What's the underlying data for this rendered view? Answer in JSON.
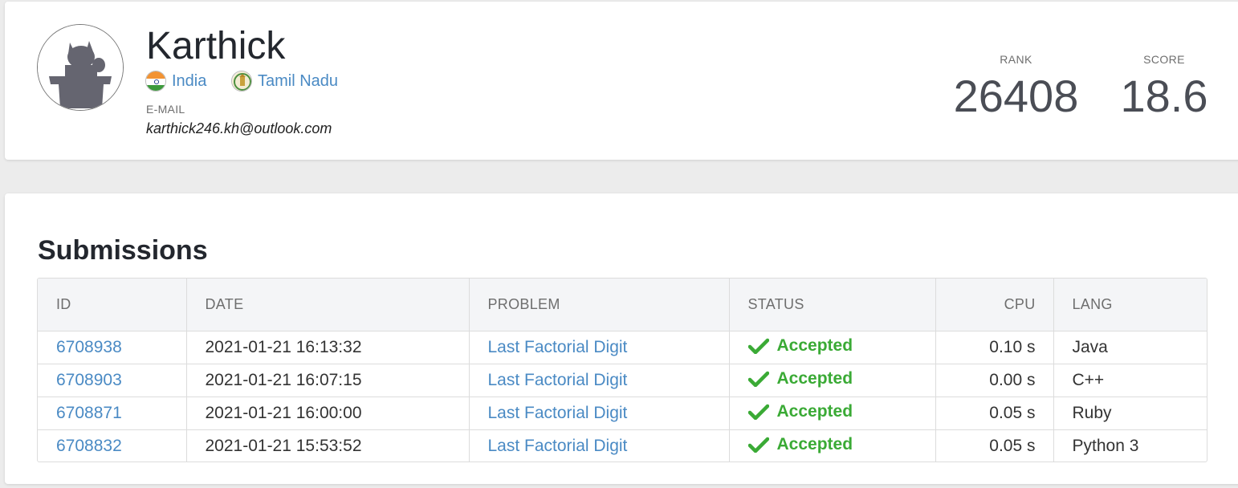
{
  "profile": {
    "name": "Karthick",
    "country": "India",
    "state": "Tamil Nadu",
    "email_label": "E-MAIL",
    "email": "karthick246.kh@outlook.com",
    "avatar_icon": "cat-avatar-icon"
  },
  "stats": {
    "rank_label": "RANK",
    "rank_value": "26408",
    "score_label": "SCORE",
    "score_value": "18.6"
  },
  "submissions": {
    "title": "Submissions",
    "columns": {
      "id": "ID",
      "date": "DATE",
      "problem": "PROBLEM",
      "status": "STATUS",
      "cpu": "CPU",
      "lang": "LANG"
    },
    "rows": [
      {
        "id": "6708938",
        "date": "2021-01-21 16:13:32",
        "problem": "Last Factorial Digit",
        "status": "Accepted",
        "cpu": "0.10 s",
        "lang": "Java"
      },
      {
        "id": "6708903",
        "date": "2021-01-21 16:07:15",
        "problem": "Last Factorial Digit",
        "status": "Accepted",
        "cpu": "0.00 s",
        "lang": "C++"
      },
      {
        "id": "6708871",
        "date": "2021-01-21 16:00:00",
        "problem": "Last Factorial Digit",
        "status": "Accepted",
        "cpu": "0.05 s",
        "lang": "Ruby"
      },
      {
        "id": "6708832",
        "date": "2021-01-21 15:53:52",
        "problem": "Last Factorial Digit",
        "status": "Accepted",
        "cpu": "0.05 s",
        "lang": "Python 3"
      }
    ]
  },
  "colors": {
    "link": "#4a8ac4",
    "accepted": "#3aaa35",
    "page_background": "#ececec"
  }
}
